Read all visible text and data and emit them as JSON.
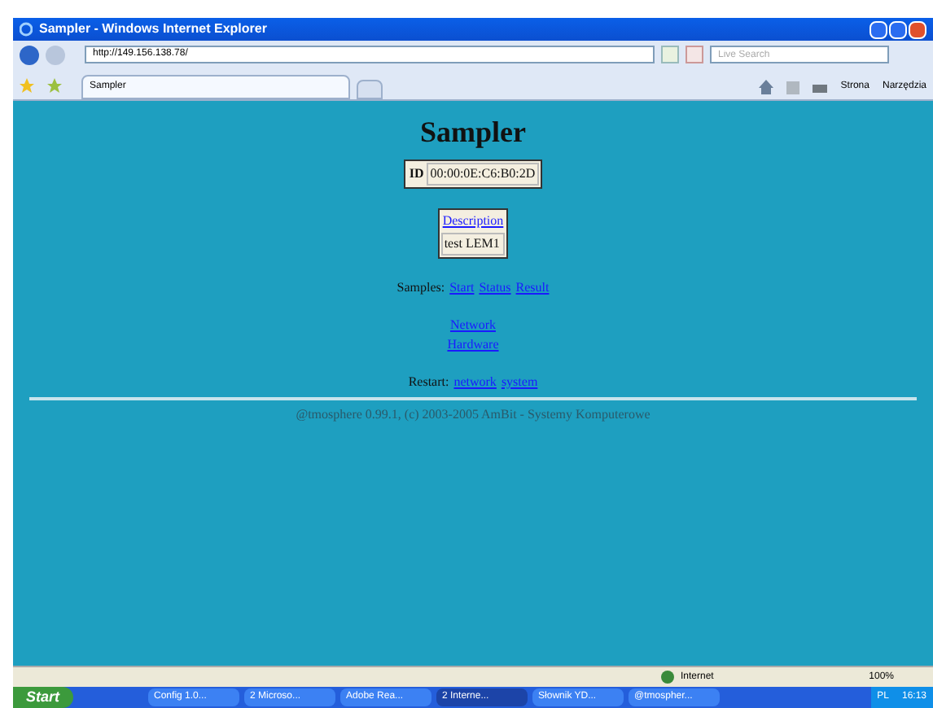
{
  "window": {
    "title": "Sampler - Windows Internet Explorer"
  },
  "address_bar": {
    "url": "http://149.156.138.78/"
  },
  "search": {
    "placeholder": "Live Search"
  },
  "tabs": [
    {
      "label": "Sampler",
      "selected": true
    }
  ],
  "toolbar": {
    "page_menu": "Strona",
    "tools_menu": "Narzędzia"
  },
  "page": {
    "heading": "Sampler",
    "id_label": "ID",
    "id_value": "00:00:0E:C6:B0:2D",
    "description_link": "Description",
    "description_value": "test LEM1",
    "samples_label": "Samples:",
    "samples_links": [
      "Start",
      "Status",
      "Result"
    ],
    "config_links": [
      "Network",
      "Hardware"
    ],
    "restart_label": "Restart:",
    "restart_links": [
      "network",
      "system"
    ],
    "footer": "@tmosphere 0.99.1, (c) 2003-2005 AmBit - Systemy Komputerowe"
  },
  "status_bar": {
    "zone": "Internet",
    "zoom": "100%"
  },
  "taskbar": {
    "start": "Start",
    "items": [
      {
        "label": "Config 1.0...",
        "selected": false
      },
      {
        "label": "2 Microso...",
        "selected": false
      },
      {
        "label": "Adobe Rea...",
        "selected": false
      },
      {
        "label": "2 Interne...",
        "selected": true
      },
      {
        "label": "Słownik YD...",
        "selected": false
      },
      {
        "label": "@tmospher...",
        "selected": false
      }
    ],
    "language": "PL",
    "clock": "16:13"
  }
}
